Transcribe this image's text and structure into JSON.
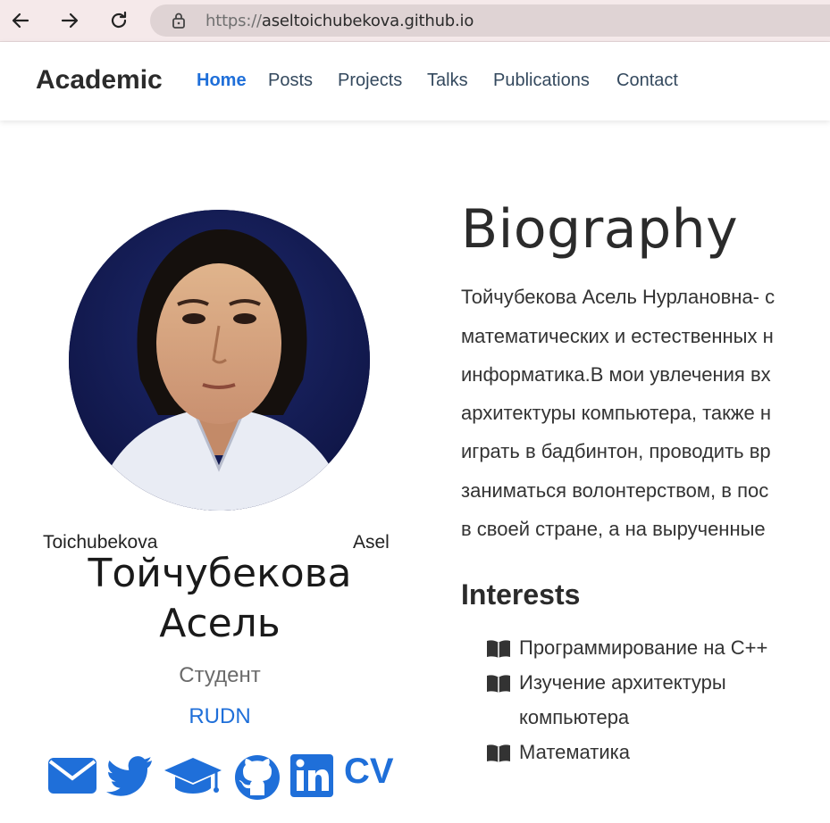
{
  "browser": {
    "url_protocol": "https://",
    "url_host": "aseltoichubekova.github.io"
  },
  "navbar": {
    "brand": "Academic",
    "items": [
      "Home",
      "Posts",
      "Projects",
      "Talks",
      "Publications",
      "Contact"
    ]
  },
  "profile": {
    "avatar_alt_left": "Toichubekova",
    "avatar_alt_right": "Asel",
    "name_line1": "Тойчубекова",
    "name_line2": "Асель",
    "role": "Студент",
    "organization": "RUDN",
    "cv_label": "CV",
    "social_icons": [
      "envelope-icon",
      "twitter-icon",
      "graduation-cap-icon",
      "github-icon",
      "linkedin-icon"
    ],
    "accent_color": "#1f6fd9"
  },
  "biography": {
    "title": "Biography",
    "lines": [
      "Тойчубекова Асель Нурлановна- с",
      "математических и естественных н",
      "информатика.В мои увлечения вх",
      "архитектуры компьютера, также н",
      "играть в бадбинтон, проводить вр",
      "заниматься волонтерством, в пос",
      "в своей стране, а на вырученные"
    ]
  },
  "interests": {
    "title": "Interests",
    "items": [
      {
        "icon": "book-icon",
        "lines": [
          "Программирование на C++"
        ]
      },
      {
        "icon": "book-icon",
        "lines": [
          "Изучение архитектуры",
          "компьютера"
        ]
      },
      {
        "icon": "book-icon",
        "lines": [
          "Математика"
        ]
      }
    ]
  }
}
